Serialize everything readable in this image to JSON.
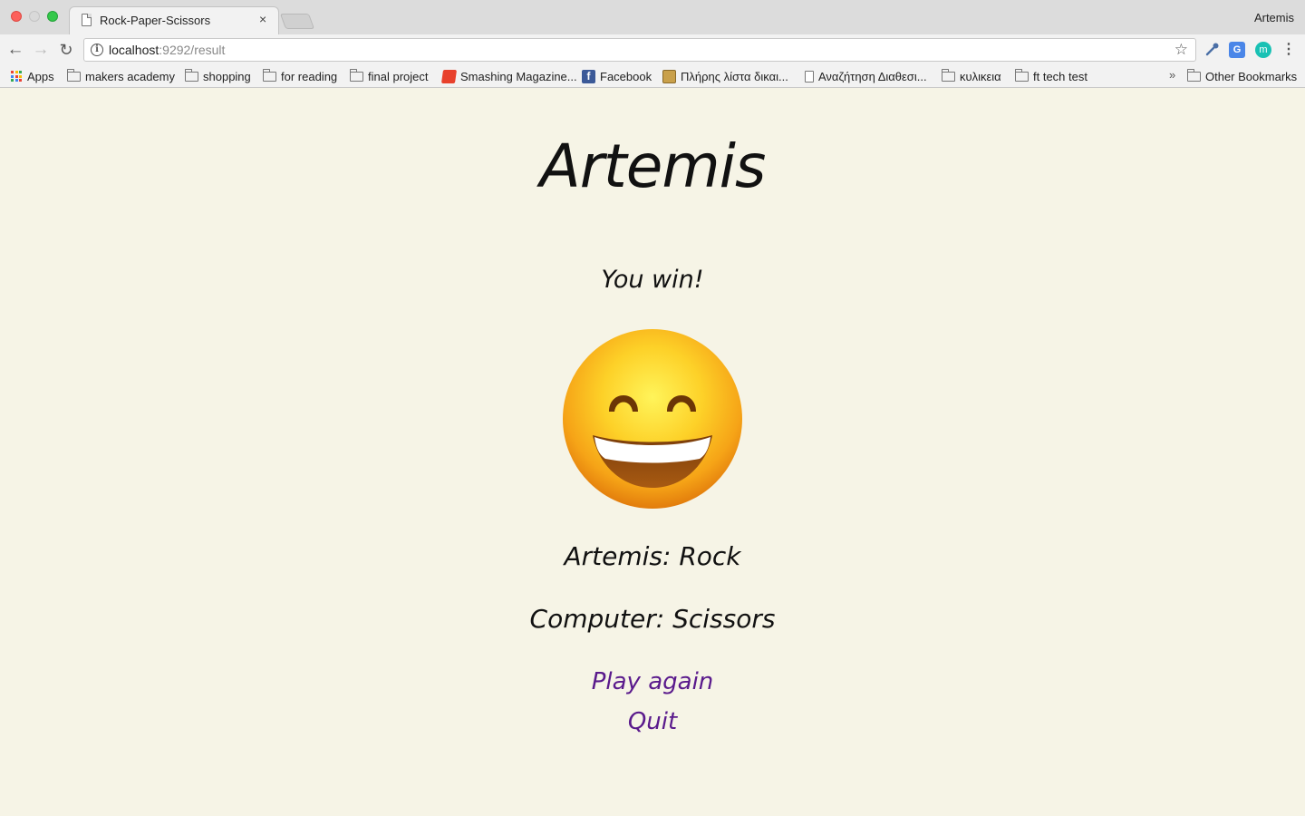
{
  "browser": {
    "tab_title": "Rock-Paper-Scissors",
    "tab_close": "×",
    "profile_name": "Artemis",
    "url_host": "localhost",
    "url_rest": ":9292/result",
    "nav": {
      "back": "←",
      "forward": "→",
      "reload": "↻"
    },
    "icons": {
      "info": "i",
      "star": "☆",
      "menu": "⋮",
      "translate": "G",
      "m_extension": "m",
      "bookmarks_overflow": "»"
    }
  },
  "bookmarks": [
    {
      "label": "Apps",
      "icon": "apps-grid-icon"
    },
    {
      "label": "makers academy",
      "icon": "folder-icon"
    },
    {
      "label": "shopping",
      "icon": "folder-icon"
    },
    {
      "label": "for reading",
      "icon": "folder-icon"
    },
    {
      "label": "final project",
      "icon": "folder-icon"
    },
    {
      "label": "Smashing Magazine...",
      "icon": "smashing-icon"
    },
    {
      "label": "Facebook",
      "icon": "facebook-icon"
    },
    {
      "label": "Πλήρης λίστα δικαι...",
      "icon": "box-icon"
    },
    {
      "label": "Αναζήτηση Διαθεσι...",
      "icon": "document-icon"
    },
    {
      "label": "κυλικεια",
      "icon": "folder-icon"
    },
    {
      "label": "ft tech test",
      "icon": "folder-icon"
    },
    {
      "label": "Other Bookmarks",
      "icon": "folder-icon"
    }
  ],
  "game": {
    "player_name": "Artemis",
    "result_message": "You win!",
    "result_icon": "grinning-face-icon",
    "player_move_line": "Artemis: Rock",
    "computer_move_line": "Computer: Scissors",
    "play_again_label": "Play again",
    "quit_label": "Quit"
  },
  "colors": {
    "page_background": "#f6f4e6",
    "link": "#5a1a8c",
    "text": "#111111"
  }
}
